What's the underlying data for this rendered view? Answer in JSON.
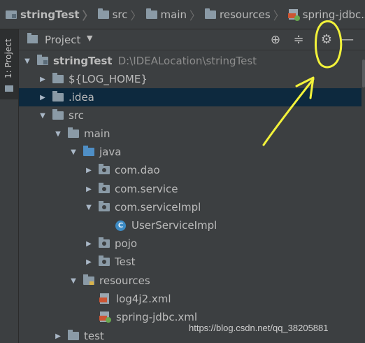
{
  "breadcrumb": {
    "items": [
      {
        "label": "stringTest",
        "icon": "project-folder-icon"
      },
      {
        "label": "src",
        "icon": "folder-icon"
      },
      {
        "label": "main",
        "icon": "folder-icon"
      },
      {
        "label": "resources",
        "icon": "resources-folder-icon"
      },
      {
        "label": "spring-jdbc.xml",
        "icon": "spring-xml-file-icon"
      }
    ]
  },
  "side_tab": {
    "label": "1: Project"
  },
  "tool_window": {
    "title": "Project",
    "dropdown_icon": "▼",
    "buttons": [
      {
        "name": "locate-icon",
        "glyph": "⊕"
      },
      {
        "name": "collapse-all-icon",
        "glyph": "≑"
      },
      {
        "name": "gear-icon",
        "glyph": "⚙"
      },
      {
        "name": "hide-icon",
        "glyph": "—"
      }
    ]
  },
  "tree": {
    "rows": [
      {
        "label": "stringTest",
        "path": "D:\\IDEALocation\\stringTest"
      },
      {
        "label": "${LOG_HOME}"
      },
      {
        "label": ".idea"
      },
      {
        "label": "src"
      },
      {
        "label": "main"
      },
      {
        "label": "java"
      },
      {
        "label": "com.dao"
      },
      {
        "label": "com.service"
      },
      {
        "label": "com.serviceImpl"
      },
      {
        "label": "UserServiceImpl",
        "badge": "C"
      },
      {
        "label": "pojo"
      },
      {
        "label": "Test"
      },
      {
        "label": "resources"
      },
      {
        "label": "log4j2.xml"
      },
      {
        "label": "spring-jdbc.xml"
      },
      {
        "label": "test"
      }
    ]
  },
  "watermark": "https://blog.csdn.net/qq_38205881",
  "colors": {
    "background": "#3c3f41",
    "selection": "#0d293e",
    "annotation": "#f2f23a"
  }
}
